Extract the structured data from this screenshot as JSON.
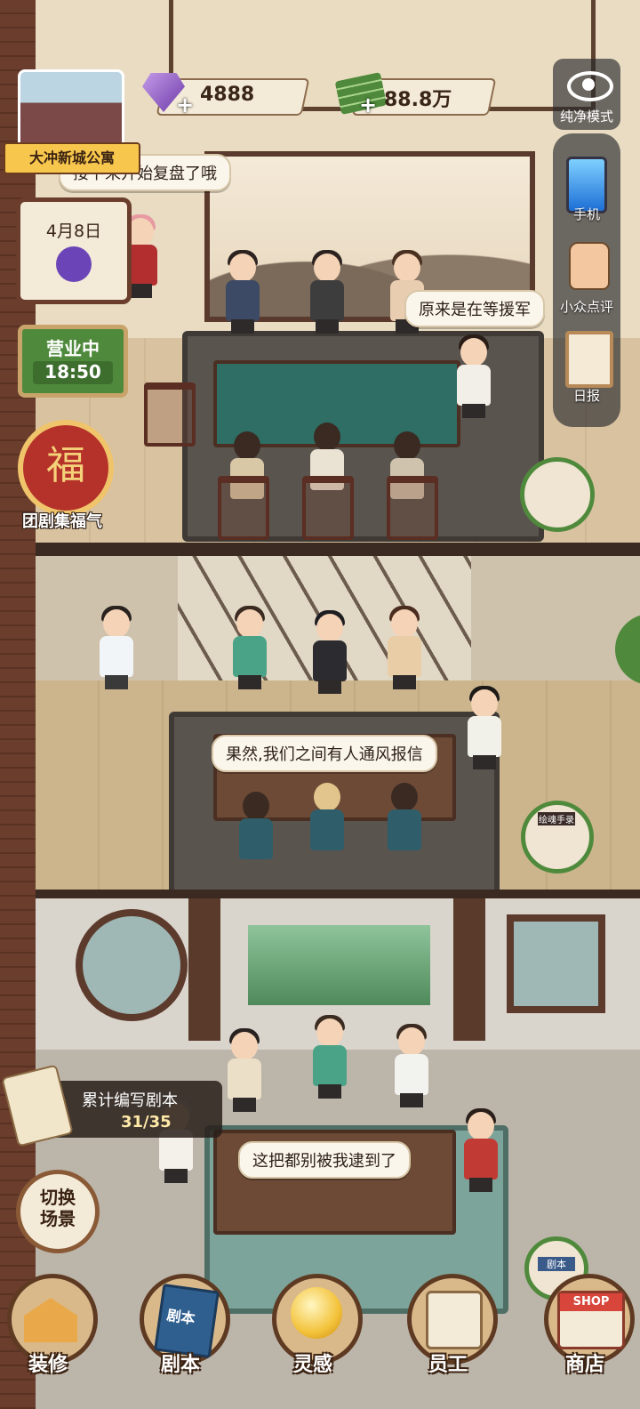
{
  "hud": {
    "gems": "4888",
    "cash": "88.8万",
    "pure_mode": "纯净模式",
    "plus": "+"
  },
  "store": {
    "name": "大冲新城公寓",
    "date": "4月8日",
    "status": "营业中",
    "time": "18:50"
  },
  "side_menu": {
    "phone": "手机",
    "review": "小众点评",
    "daily": "日报"
  },
  "event": {
    "label": "团剧集福气",
    "badge_char": "福"
  },
  "bubbles": {
    "b1": "接下来开始复盘了哦",
    "b2": "原来是在等援军",
    "b3": "果然,我们之间有人通风报信",
    "b4": "这把都别被我逮到了"
  },
  "script_progress": {
    "label": "累计编写剧本",
    "count": "31/35"
  },
  "switch_scene": "切换\n场景",
  "small_tags": {
    "script_tag": "剧本",
    "book_tag": "绘魂手录"
  },
  "nav": [
    "装修",
    "剧本",
    "灵感",
    "员工",
    "商店"
  ],
  "shop_sign": "SHOP",
  "book_cover": "剧本",
  "colors": {
    "wood": "#6b3d2c",
    "cream": "#f3ead8",
    "green": "#4f8a3c"
  }
}
